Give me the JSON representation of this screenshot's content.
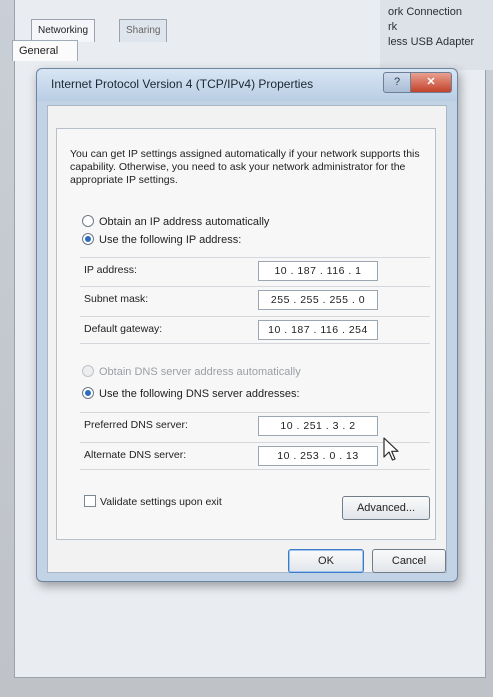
{
  "background": {
    "tabs": [
      "Networking",
      "Sharing"
    ],
    "right_lines": [
      "ork Connection",
      "rk",
      "less USB Adapter"
    ]
  },
  "dialog": {
    "title": "Internet Protocol Version 4 (TCP/IPv4) Properties",
    "help_label": "?",
    "close_label": "✕",
    "tab": "General",
    "description": "You can get IP settings assigned automatically if your network supports this capability. Otherwise, you need to ask your network administrator for the appropriate IP settings.",
    "ip_section": {
      "obtain_auto_label": "Obtain an IP address automatically",
      "use_following_label": "Use the following IP address:",
      "fields": [
        {
          "label": "IP address:",
          "value": "10 . 187 . 116 . 1"
        },
        {
          "label": "Subnet mask:",
          "value": "255 . 255 . 255 . 0"
        },
        {
          "label": "Default gateway:",
          "value": "10 . 187 . 116 . 254"
        }
      ]
    },
    "dns_section": {
      "obtain_auto_label": "Obtain DNS server address automatically",
      "use_following_label": "Use the following DNS server addresses:",
      "fields": [
        {
          "label": "Preferred DNS server:",
          "value": "10 . 251 . 3 . 2"
        },
        {
          "label": "Alternate DNS server:",
          "value": "10 . 253 . 0 . 13"
        }
      ]
    },
    "validate_label": "Validate settings upon exit",
    "advanced_label": "Advanced...",
    "ok_label": "OK",
    "cancel_label": "Cancel"
  },
  "colors": {
    "titlebar": "#c3d3e6",
    "close_button": "#c3422c",
    "radio_selected": "#2c6cc1"
  },
  "icons": {
    "cursor": "mouse-pointer-icon"
  }
}
